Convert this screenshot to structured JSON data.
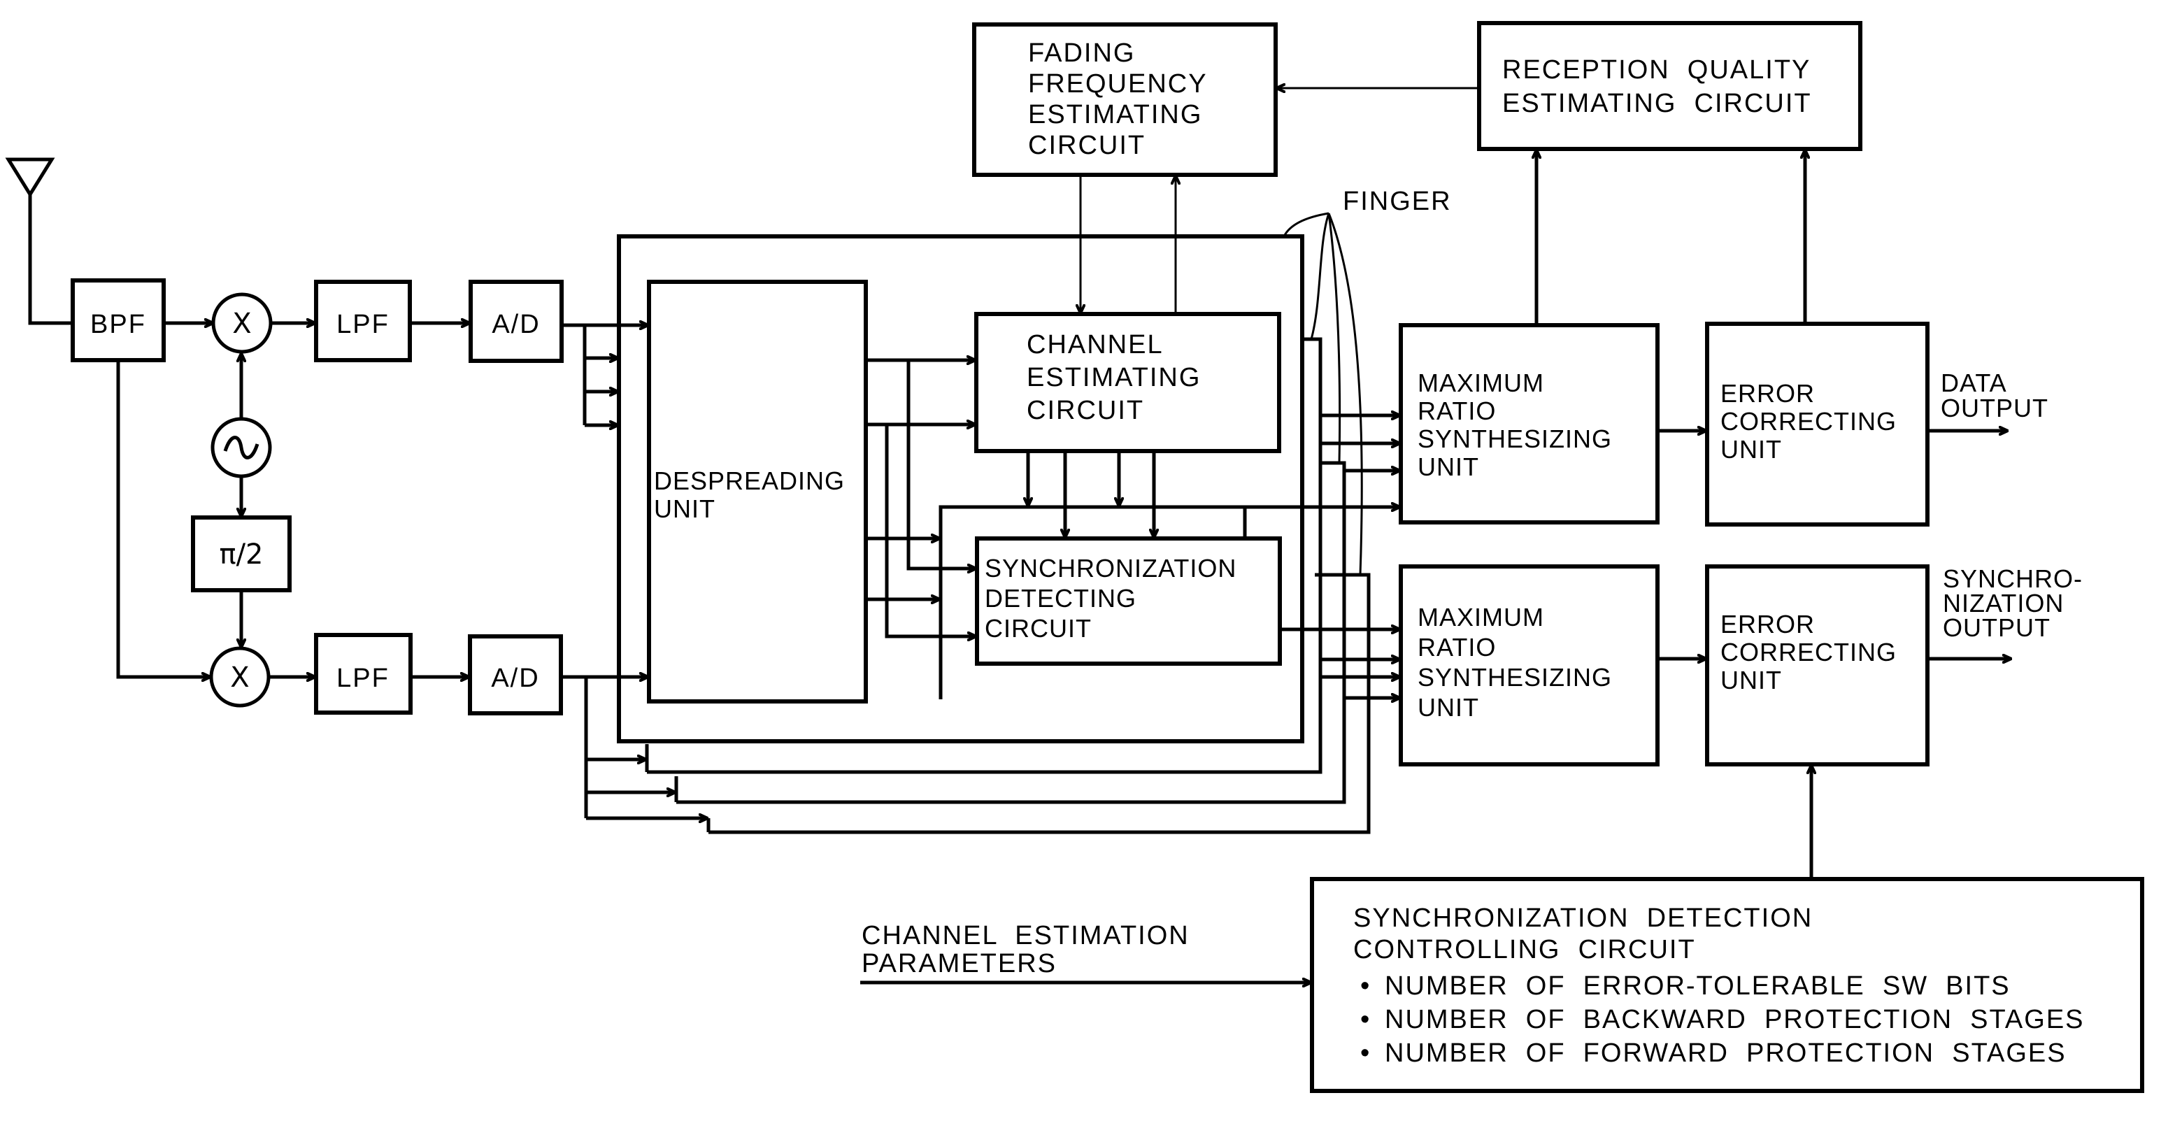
{
  "diagram": {
    "antenna": {
      "icon": "antenna-icon"
    },
    "rf_chain": {
      "bpf": "BPF",
      "mixer_symbol": "X",
      "oscillator_symbol": "~",
      "phase_shift": "π/2",
      "lpf": "LPF",
      "adc": "A/D"
    },
    "finger_label": "FINGER",
    "despreading_unit": [
      "DESPREADING",
      "UNIT"
    ],
    "channel_estimating_circuit": [
      "CHANNEL",
      "ESTIMATING",
      "CIRCUIT"
    ],
    "synchronization_detecting_circuit": [
      "SYNCHRONIZATION",
      "DETECTING",
      "CIRCUIT"
    ],
    "fading_frequency_estimating_circuit": [
      "FADING",
      "FREQUENCY",
      "ESTIMATING",
      "CIRCUIT"
    ],
    "reception_quality_estimating_circuit": [
      "RECEPTION  QUALITY",
      "ESTIMATING  CIRCUIT"
    ],
    "max_ratio_synthesizing_unit": [
      "MAXIMUM",
      "RATIO",
      "SYNTHESIZING",
      "UNIT"
    ],
    "error_correcting_unit": [
      "ERROR",
      "CORRECTING",
      "UNIT"
    ],
    "data_output": [
      "DATA",
      "OUTPUT"
    ],
    "synchronization_output": [
      "SYNCHRO-",
      "NIZATION",
      "OUTPUT"
    ],
    "channel_estimation_parameters": [
      "CHANNEL  ESTIMATION",
      "PARAMETERS"
    ],
    "sync_detection_controlling_circuit": {
      "title": [
        "SYNCHRONIZATION  DETECTION",
        "CONTROLLING  CIRCUIT"
      ],
      "bullets": [
        "NUMBER  OF  ERROR-TOLERABLE  SW  BITS",
        "NUMBER  OF  BACKWARD  PROTECTION  STAGES",
        "NUMBER  OF  FORWARD  PROTECTION  STAGES"
      ],
      "bullet_symbol": "•"
    }
  }
}
